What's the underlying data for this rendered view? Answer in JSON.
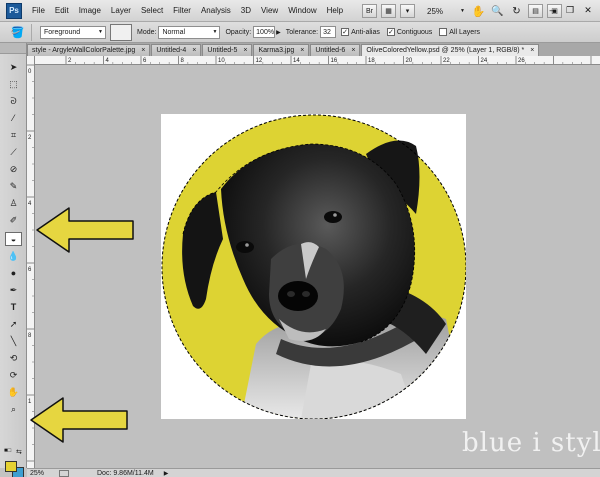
{
  "app": {
    "logo": "Ps",
    "menu": [
      "File",
      "Edit",
      "Image",
      "Layer",
      "Select",
      "Filter",
      "Analysis",
      "3D",
      "View",
      "Window",
      "Help"
    ],
    "zoom": "25%"
  },
  "options": {
    "fill_source": "Foreground",
    "mode_label": "Mode:",
    "mode_value": "Normal",
    "opacity_label": "Opacity:",
    "opacity_value": "100%",
    "tolerance_label": "Tolerance:",
    "tolerance_value": "32",
    "antialias_label": "Anti-alias",
    "contiguous_label": "Contiguous",
    "all_layers_label": "All Layers"
  },
  "tabs": [
    {
      "label": "style - ArgyleWallColorPalette.jpg",
      "active": false
    },
    {
      "label": "Untitled-4",
      "active": false
    },
    {
      "label": "Untitled-5",
      "active": false
    },
    {
      "label": "Karma3.jpg",
      "active": false
    },
    {
      "label": "Untitled-6",
      "active": false
    },
    {
      "label": "OliveColoredYellow.psd @ 25% (Layer 1, RGB/8) *",
      "active": true
    }
  ],
  "ruler": {
    "top": [
      "2",
      "4",
      "6",
      "8",
      "10",
      "12",
      "14",
      "16",
      "18",
      "20",
      "22",
      "24",
      "26"
    ],
    "left": [
      "0",
      "2",
      "4",
      "6",
      "8",
      "1"
    ]
  },
  "status": {
    "zoom": "25%",
    "doc": "Doc: 9.86M/11.4M"
  },
  "colors": {
    "foreground": "#e5d233",
    "background": "#3e9fd1",
    "circle_fill": "#ddd333",
    "arrow_fill": "#e6d640"
  },
  "watermark": "blue i style",
  "icons": [
    "move-icon",
    "marquee-icon",
    "lasso-icon",
    "quick-select-icon",
    "crop-icon",
    "eyedropper-icon",
    "healing-icon",
    "brush-icon",
    "stamp-icon",
    "history-brush-icon",
    "eraser-icon",
    "paint-bucket-icon",
    "blur-icon",
    "dodge-icon",
    "pen-icon",
    "type-icon",
    "path-select-icon",
    "shape-icon",
    "3d-rotate-icon",
    "3d-orbit-icon",
    "hand-icon",
    "zoom-icon"
  ]
}
